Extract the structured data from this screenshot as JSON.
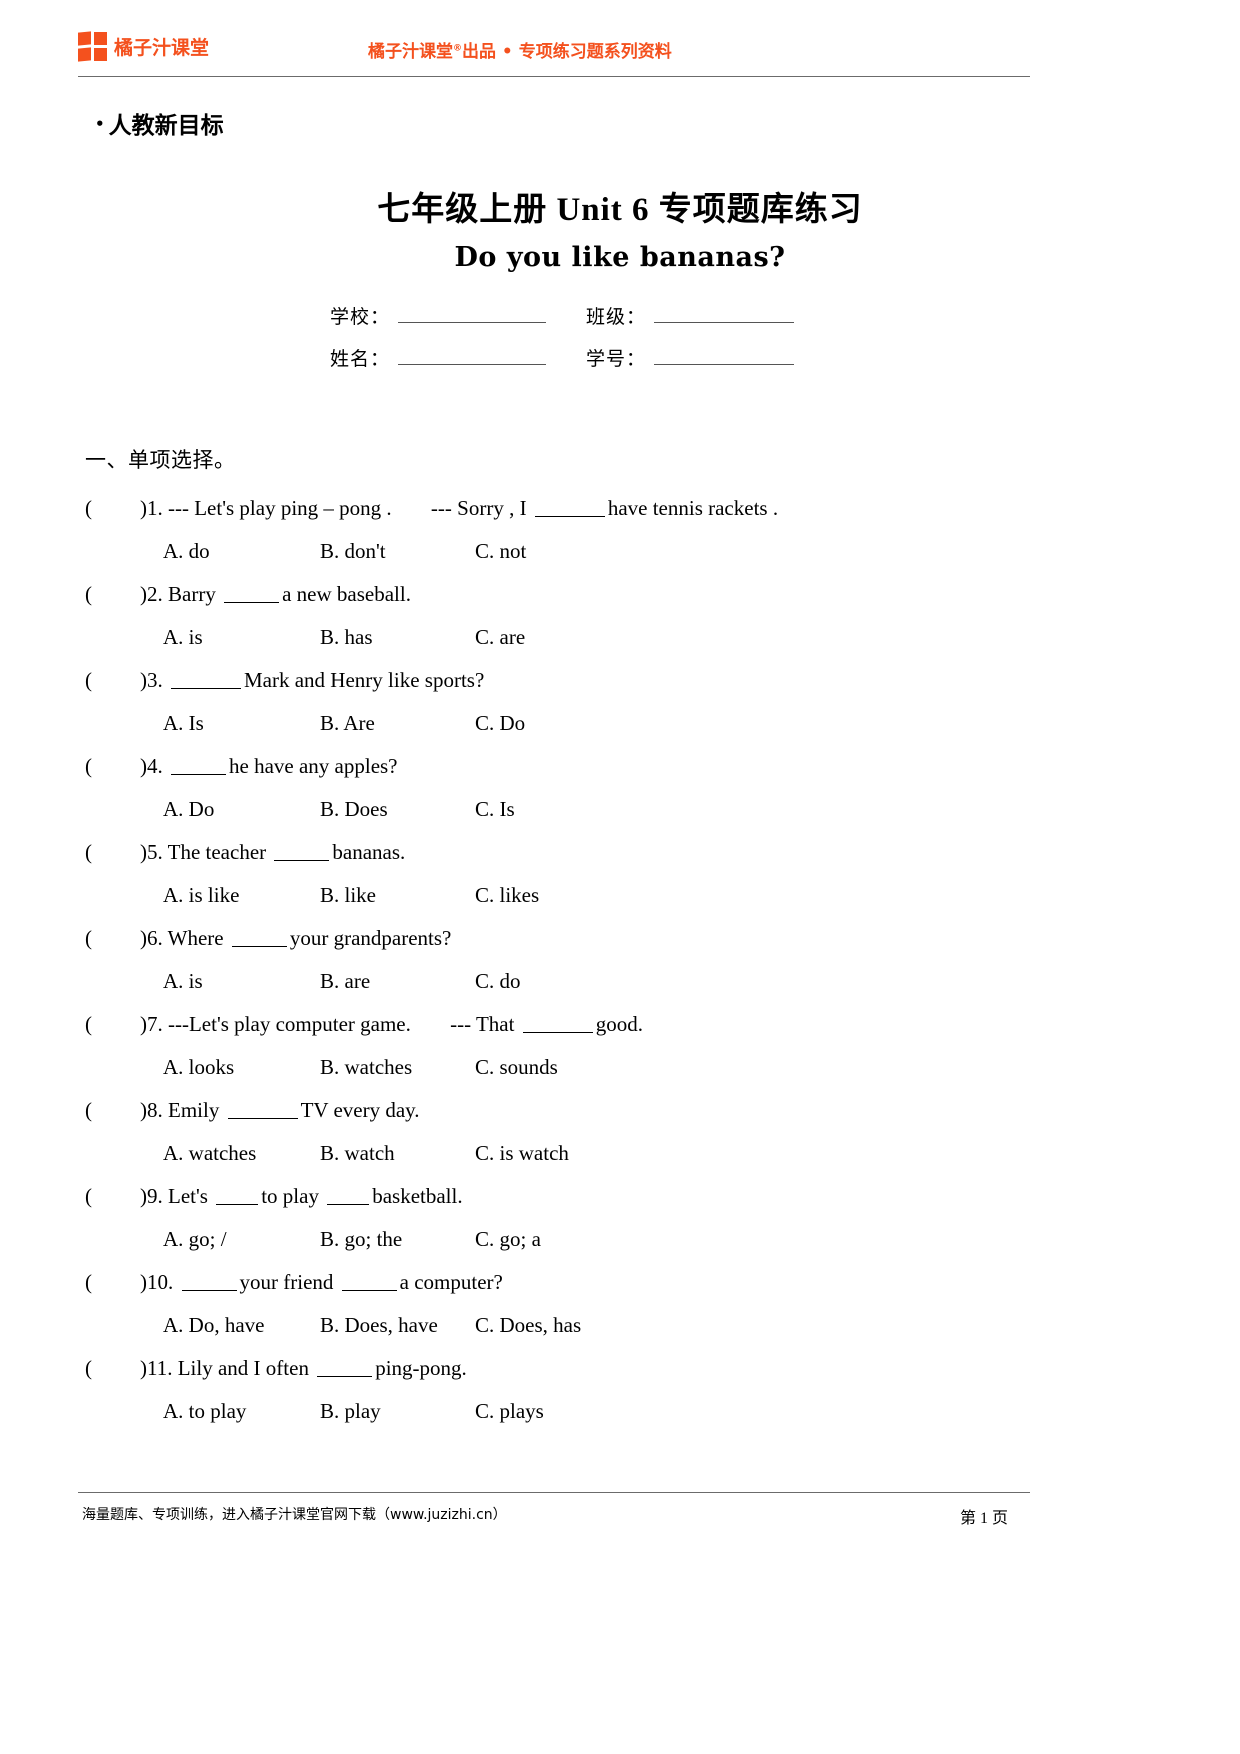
{
  "header": {
    "brand_name": "橘子汁课堂",
    "brand_logo_icon": "four-square-grid-icon",
    "center_text_before": "橘子汁课堂",
    "center_text_mark": "®",
    "center_text_after": "出品 • 专项练习题系列资料",
    "brand_color": "#f4511e"
  },
  "series_label": "人教新目标",
  "title": "七年级上册 Unit 6  专项题库练习",
  "subtitle": "Do you like bananas?",
  "student_info": {
    "school_label": "学校：",
    "class_label": "班级：",
    "name_label": "姓名：",
    "student_id_label": "学号："
  },
  "section": {
    "heading": "一、单项选择。"
  },
  "questions": [
    {
      "paren": "(",
      "paren_close": ")",
      "number": "1.",
      "stem_parts": [
        "--- Let's play ping – pong .",
        "--- Sorry , I",
        "have tennis rackets ."
      ],
      "blank_size": "b-md",
      "options": [
        "A. do",
        "B. don't",
        "C. not"
      ]
    },
    {
      "paren": "(",
      "paren_close": ")",
      "number": "2.",
      "stem_parts": [
        "Barry",
        "a new baseball."
      ],
      "blank_size": "b-sm",
      "options": [
        "A. is",
        "B. has",
        "C. are"
      ]
    },
    {
      "paren": "(",
      "paren_close": ")",
      "number": "3.",
      "stem_parts": [
        "",
        "Mark and Henry like sports?"
      ],
      "blank_size": "b-md",
      "options": [
        "A. Is",
        "B. Are",
        "C. Do"
      ]
    },
    {
      "paren": "(",
      "paren_close": ")",
      "number": "4.",
      "stem_parts": [
        "",
        "he have any apples?"
      ],
      "blank_size": "b-sm",
      "options": [
        "A. Do",
        "B. Does",
        "C. Is"
      ]
    },
    {
      "paren": "(",
      "paren_close": ")",
      "number": "5.",
      "stem_parts": [
        "The teacher",
        "bananas."
      ],
      "blank_size": "b-sm",
      "options": [
        "A. is like",
        "B. like",
        "C. likes"
      ]
    },
    {
      "paren": "(",
      "paren_close": ")",
      "number": "6.",
      "stem_parts": [
        "Where",
        "your grandparents?"
      ],
      "blank_size": "b-sm",
      "options": [
        "A. is",
        "B. are",
        "C. do"
      ]
    },
    {
      "paren": "(",
      "paren_close": ")",
      "number": "7.",
      "stem_parts": [
        "---Let's play computer game.",
        "--- That",
        "good."
      ],
      "blank_size": "b-md",
      "options": [
        "A. looks",
        "B. watches",
        "C. sounds"
      ]
    },
    {
      "paren": "(",
      "paren_close": ")",
      "number": "8.",
      "stem_parts": [
        "Emily",
        "TV every day."
      ],
      "blank_size": "b-md",
      "options": [
        "A. watches",
        "B. watch",
        "C. is watch"
      ]
    },
    {
      "paren": "(",
      "paren_close": ")",
      "number": "9.",
      "stem_parts": [
        "Let's",
        "to play",
        "basketball."
      ],
      "blank_size": "b-xs",
      "options": [
        "A. go; /",
        "B. go; the",
        "C. go; a"
      ]
    },
    {
      "paren": "(",
      "paren_close": ")",
      "number": "10.",
      "stem_parts": [
        "",
        "your friend",
        "a computer?"
      ],
      "blank_size": "b-sm",
      "options": [
        "A. Do, have",
        "B. Does, have",
        "C. Does, has"
      ]
    },
    {
      "paren": "(",
      "paren_close": ")",
      "number": "11.",
      "stem_parts": [
        "Lily and I often",
        "ping-pong."
      ],
      "blank_size": "b-sm",
      "options": [
        "A. to play",
        "B. play",
        "C. plays"
      ]
    }
  ],
  "footer": {
    "left_text": "海量题库、专项训练，进入橘子汁课堂官网下载（www.juzizhi.cn）",
    "page_label": "第 1 页"
  }
}
